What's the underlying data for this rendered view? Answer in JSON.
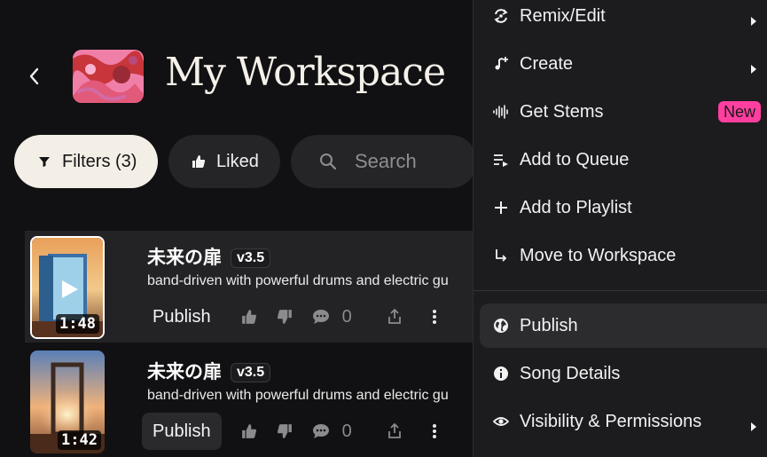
{
  "header": {
    "title": "My Workspace"
  },
  "filters": {
    "filters_label": "Filters (3)",
    "liked_label": "Liked",
    "search_placeholder": "Search"
  },
  "songs": [
    {
      "title": "未来の扉",
      "version": "v3.5",
      "description": "band-driven with powerful drums and electric gu",
      "duration": "1:48",
      "publish_label": "Publish",
      "comment_count": "0"
    },
    {
      "title": "未来の扉",
      "version": "v3.5",
      "description": "band-driven with powerful drums and electric gu",
      "duration": "1:42",
      "publish_label": "Publish",
      "comment_count": "0"
    }
  ],
  "menu": {
    "items": [
      {
        "label": "Remix/Edit",
        "icon": "remix-icon",
        "submenu": true
      },
      {
        "label": "Create",
        "icon": "create-icon",
        "submenu": true
      },
      {
        "label": "Get Stems",
        "icon": "waveform-icon",
        "badge": "New"
      },
      {
        "label": "Add to Queue",
        "icon": "queue-icon"
      },
      {
        "label": "Add to Playlist",
        "icon": "plus-icon"
      },
      {
        "label": "Move to Workspace",
        "icon": "move-arrow-icon"
      },
      {
        "label": "Publish",
        "icon": "globe-icon",
        "highlighted": true
      },
      {
        "label": "Song Details",
        "icon": "info-icon"
      },
      {
        "label": "Visibility & Permissions",
        "icon": "eye-icon",
        "submenu": true
      }
    ]
  },
  "colors": {
    "background": "#111113",
    "menu_background": "#1c1c1f",
    "new_badge": "#ff3fa0",
    "filter_pill": "#f4efe6"
  }
}
